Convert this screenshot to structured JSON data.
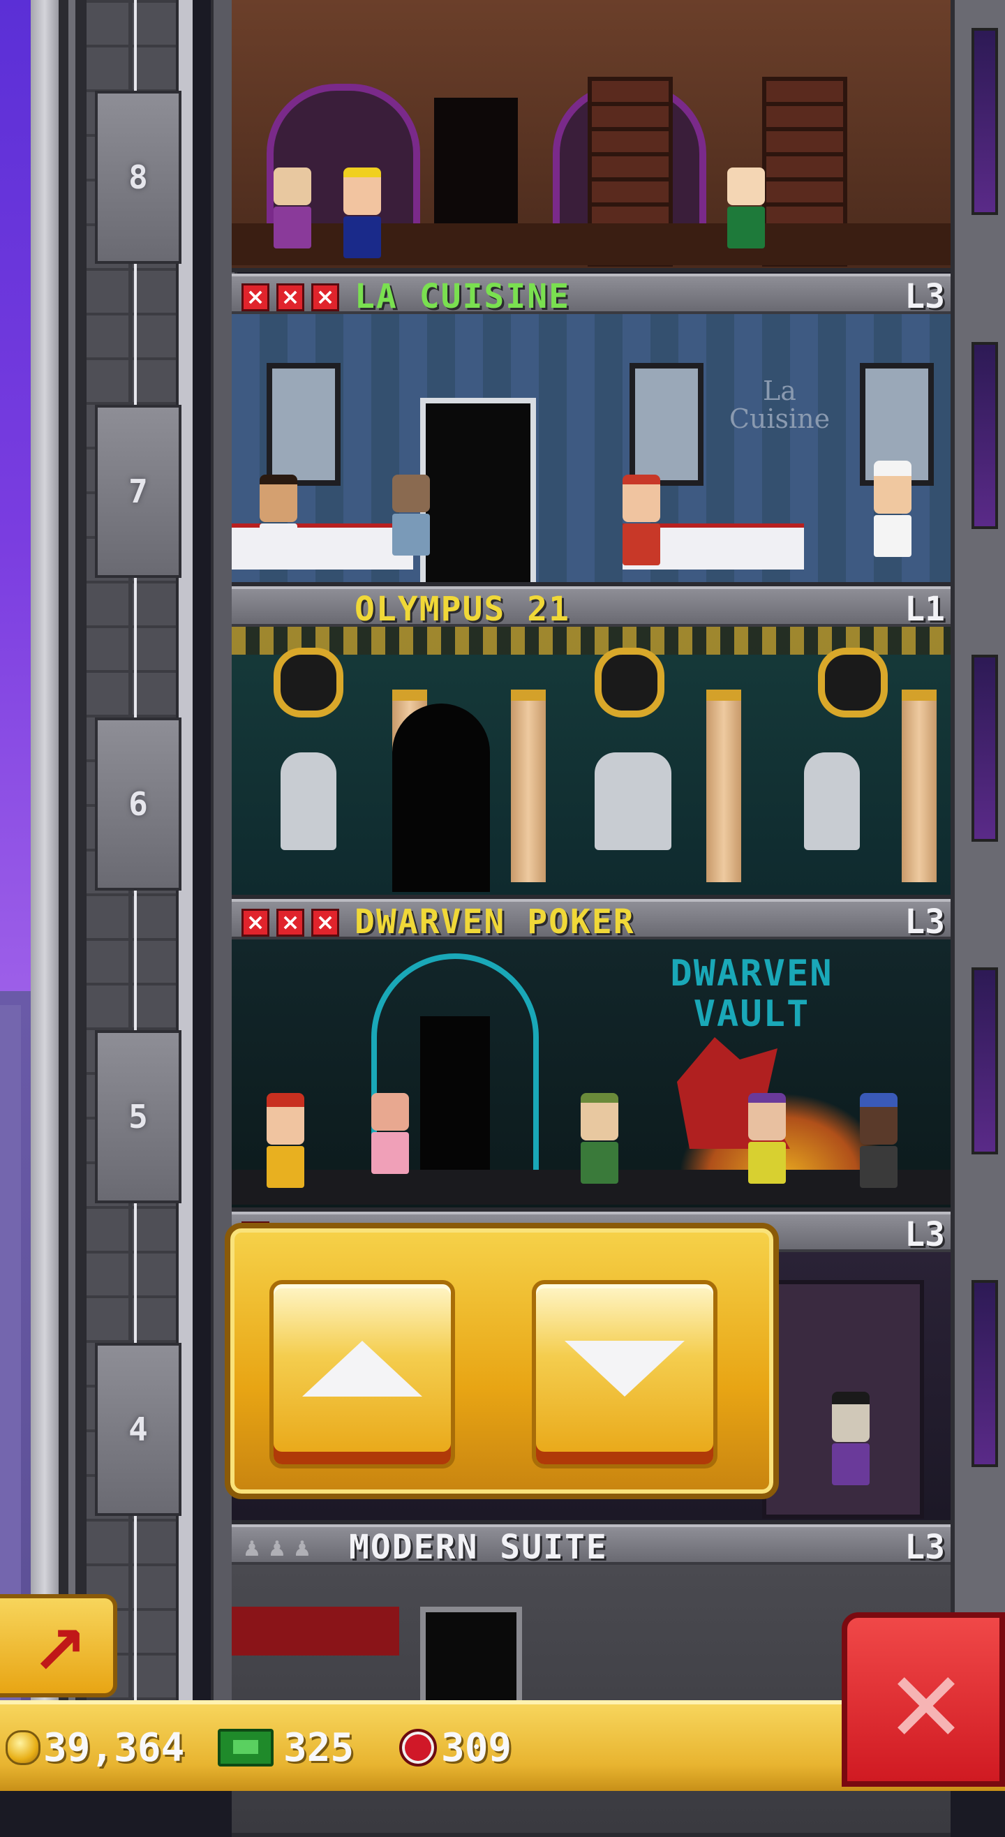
{
  "floors": [
    {
      "number": "8",
      "room": "wine"
    },
    {
      "number": "7",
      "banner": "LA CUISINE",
      "banner_color": "#7ae050",
      "level": "L3",
      "stock_out": true
    },
    {
      "number": "6",
      "banner": "OLYMPUS 21",
      "banner_color": "#f0d838",
      "level": "L1",
      "stock_out": false
    },
    {
      "number": "5",
      "banner": "DWARVEN POKER",
      "banner_color": "#f0d838",
      "level": "L3",
      "stock_out": true
    },
    {
      "number": "4",
      "banner": "",
      "level": "L3"
    },
    {
      "banner": "MODERN SUITE",
      "banner_color": "#f2f2f6",
      "level": "L3",
      "residential": true
    }
  ],
  "rooms": {
    "dining_sign": "La\nCuisine",
    "dwarf_sign": "DWARVEN\nVAULT"
  },
  "elevator": {
    "up_icon": "triangle-up-icon",
    "down_icon": "triangle-down-icon"
  },
  "hud": {
    "coins": "39,364",
    "bux": "325",
    "gems": "309"
  },
  "buttons": {
    "rocket_icon": "rocket-arrow-icon",
    "close_icon": "close-x-icon"
  },
  "colors": {
    "accent_gold": "#e8a514",
    "close_red": "#d01a22",
    "restock_red": "#e0242c"
  }
}
